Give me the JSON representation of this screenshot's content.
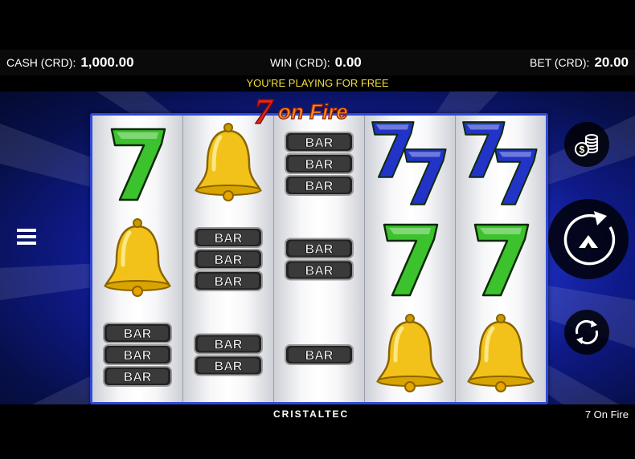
{
  "header": {
    "cash_label": "CASH (CRD):",
    "cash_value": "1,000.00",
    "win_label": "WIN (CRD):",
    "win_value": "0.00",
    "bet_label": "BET (CRD):",
    "bet_value": "20.00",
    "free_play_notice": "YOU'RE PLAYING FOR FREE"
  },
  "logo": {
    "text_7": "7",
    "text_rest": "on Fire"
  },
  "reels": [
    [
      "seven-green",
      "bell",
      "bar-triple"
    ],
    [
      "bell",
      "bar-triple",
      "bar-double"
    ],
    [
      "bar-triple",
      "bar-double",
      "bar-single"
    ],
    [
      "seven-blue-double",
      "seven-green",
      "bell"
    ],
    [
      "seven-blue-double",
      "seven-green",
      "bell"
    ]
  ],
  "symbols": {
    "bar_text": "BAR"
  },
  "controls": {
    "menu_icon": "hamburger-menu-icon",
    "coins_icon": "coin-stack-icon",
    "spin_icon": "spin-arrow-icon",
    "autoplay_icon": "autoplay-cycle-icon"
  },
  "footer": {
    "brand": "CRISTALTEC",
    "game_name": "7 On Fire"
  },
  "colors": {
    "seven_green": "#3cc22c",
    "seven_blue": "#2233c8",
    "bell_gold": "#f2c21a",
    "free_text": "#f4df3c",
    "reel_frame": "#2f4ad8"
  }
}
